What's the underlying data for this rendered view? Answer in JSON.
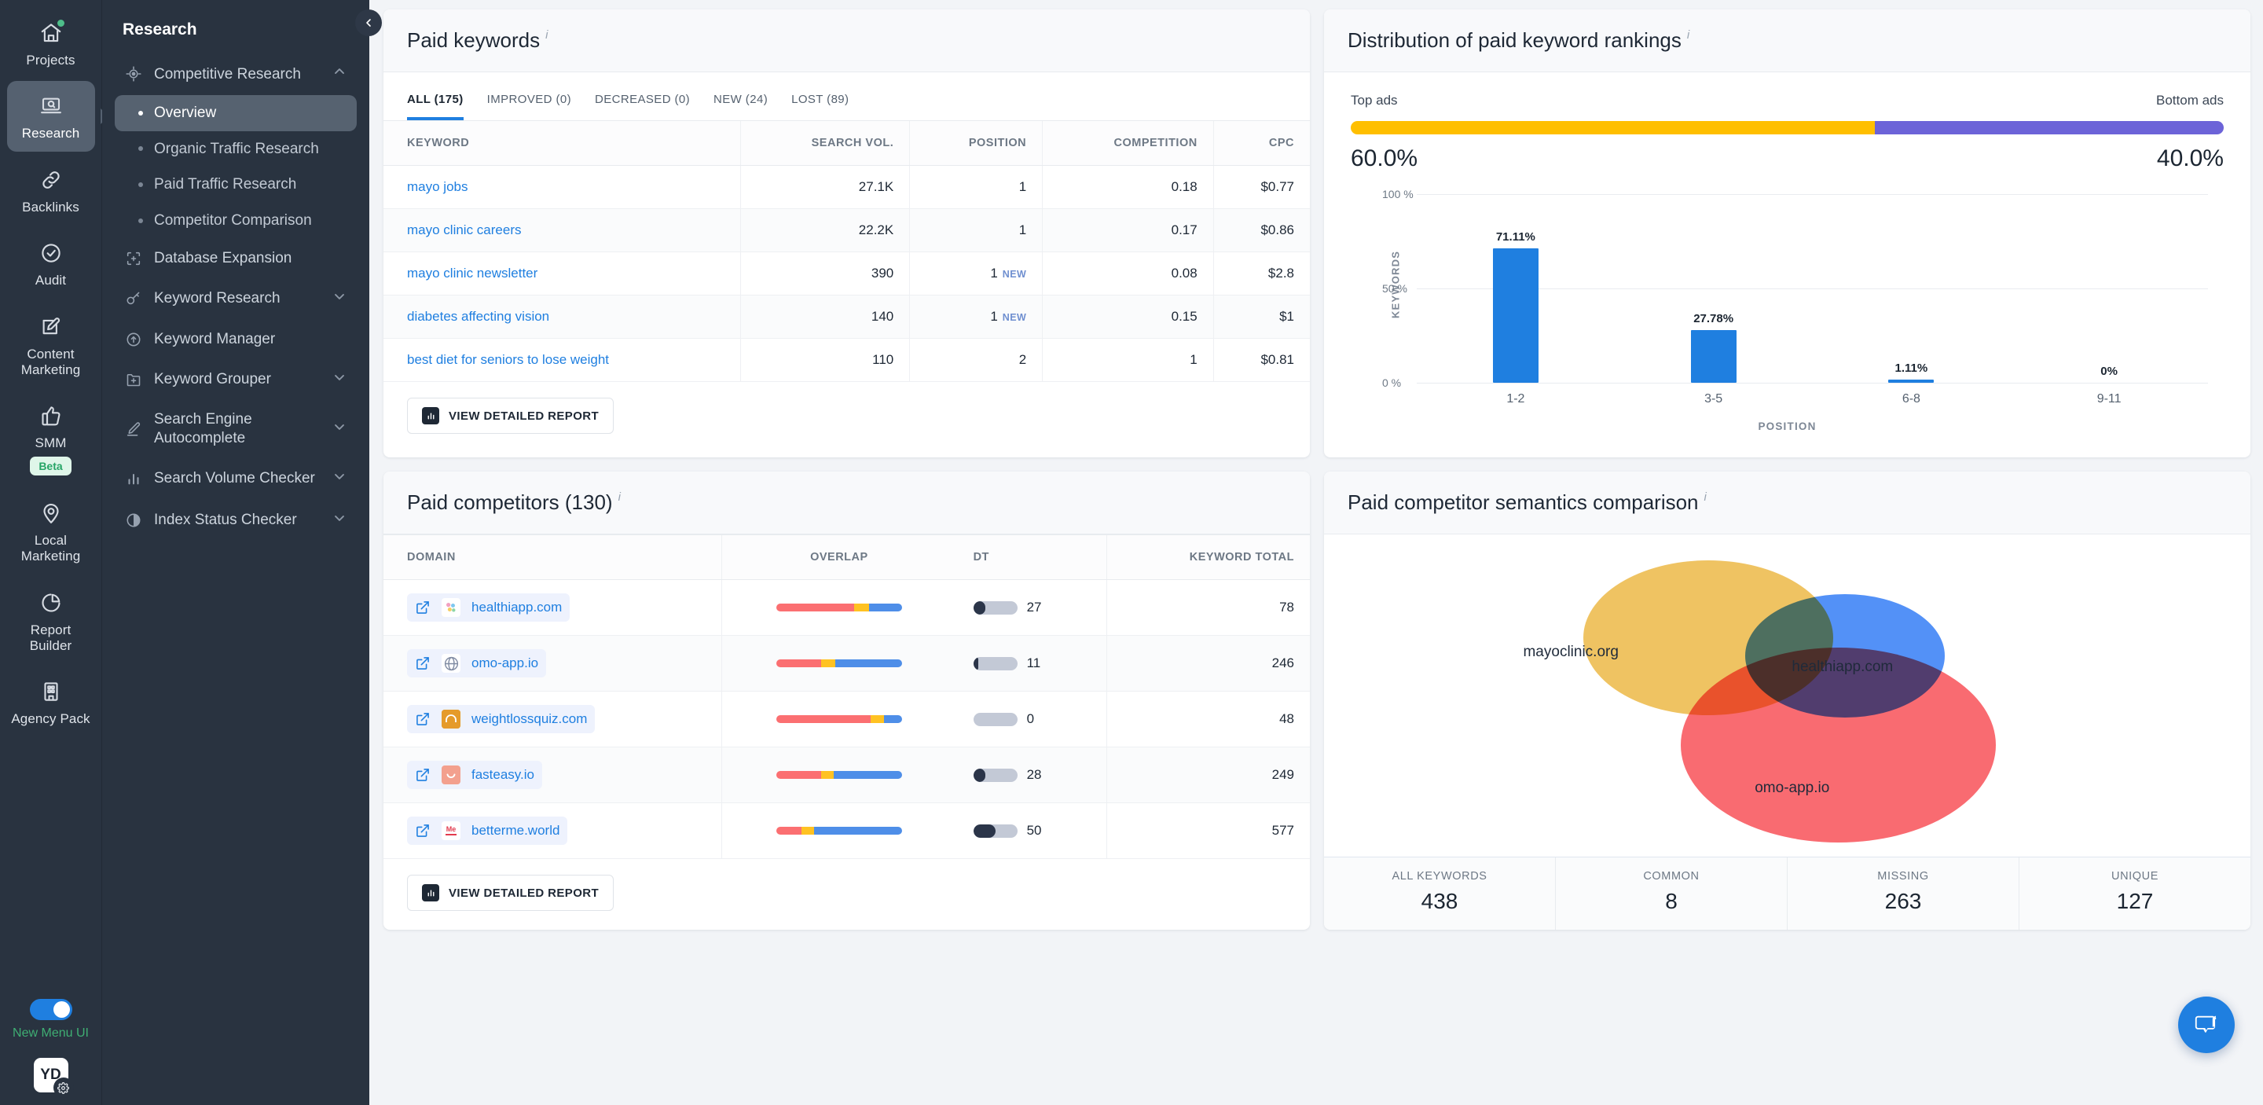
{
  "rail": {
    "items": [
      {
        "label": "Projects",
        "icon": "home-icon",
        "active": false,
        "badge_dot": true
      },
      {
        "label": "Research",
        "icon": "laptop-search-icon",
        "active": true,
        "badge_dot": false
      },
      {
        "label": "Backlinks",
        "icon": "link-icon",
        "active": false,
        "badge_dot": false
      },
      {
        "label": "Audit",
        "icon": "check-circle-icon",
        "active": false,
        "badge_dot": false
      },
      {
        "label": "Content Marketing",
        "icon": "edit-square-icon",
        "active": false,
        "badge_dot": false
      },
      {
        "label": "SMM",
        "icon": "thumbs-up-icon",
        "active": false,
        "badge_dot": false,
        "tag": "Beta"
      },
      {
        "label": "Local Marketing",
        "icon": "map-pin-icon",
        "active": false,
        "badge_dot": false
      },
      {
        "label": "Report Builder",
        "icon": "pie-chart-icon",
        "active": false,
        "badge_dot": false
      },
      {
        "label": "Agency Pack",
        "icon": "building-icon",
        "active": false,
        "badge_dot": false
      }
    ],
    "new_menu_label": "New Menu UI",
    "avatar_initials": "YD"
  },
  "nav": {
    "title": "Research",
    "groups": [
      {
        "label": "Competitive Research",
        "icon": "target-icon",
        "expanded": true,
        "chevron": "up",
        "children": [
          {
            "label": "Overview",
            "active": true
          },
          {
            "label": "Organic Traffic Research",
            "active": false
          },
          {
            "label": "Paid Traffic Research",
            "active": false
          },
          {
            "label": "Competitor Comparison",
            "active": false
          }
        ]
      },
      {
        "label": "Database Expansion",
        "icon": "expand-icon",
        "expanded": false,
        "chevron": "none",
        "children": []
      },
      {
        "label": "Keyword Research",
        "icon": "key-icon",
        "expanded": false,
        "chevron": "down",
        "children": []
      },
      {
        "label": "Keyword Manager",
        "icon": "arrow-up-circle-icon",
        "expanded": false,
        "chevron": "none",
        "children": []
      },
      {
        "label": "Keyword Grouper",
        "icon": "folder-plus-icon",
        "expanded": false,
        "chevron": "down",
        "children": []
      },
      {
        "label": "Search Engine Autocomplete",
        "icon": "pencil-icon",
        "expanded": false,
        "chevron": "down",
        "children": []
      },
      {
        "label": "Search Volume Checker",
        "icon": "bar-chart-icon",
        "expanded": false,
        "chevron": "down",
        "children": []
      },
      {
        "label": "Index Status Checker",
        "icon": "contrast-circle-icon",
        "expanded": false,
        "chevron": "down",
        "children": []
      }
    ]
  },
  "paid_keywords": {
    "title": "Paid keywords",
    "info_glyph": "i",
    "tabs": [
      {
        "label": "ALL (175)",
        "active": true
      },
      {
        "label": "IMPROVED (0)",
        "active": false
      },
      {
        "label": "DECREASED (0)",
        "active": false
      },
      {
        "label": "NEW (24)",
        "active": false
      },
      {
        "label": "LOST (89)",
        "active": false
      }
    ],
    "columns": [
      "KEYWORD",
      "SEARCH VOL.",
      "POSITION",
      "COMPETITION",
      "CPC"
    ],
    "rows": [
      {
        "keyword": "mayo jobs",
        "search_vol": "27.1K",
        "position": "1",
        "position_tag": "",
        "competition": "0.18",
        "cpc": "$0.77"
      },
      {
        "keyword": "mayo clinic careers",
        "search_vol": "22.2K",
        "position": "1",
        "position_tag": "",
        "competition": "0.17",
        "cpc": "$0.86"
      },
      {
        "keyword": "mayo clinic newsletter",
        "search_vol": "390",
        "position": "1",
        "position_tag": "NEW",
        "competition": "0.08",
        "cpc": "$2.8"
      },
      {
        "keyword": "diabetes affecting vision",
        "search_vol": "140",
        "position": "1",
        "position_tag": "NEW",
        "competition": "0.15",
        "cpc": "$1"
      },
      {
        "keyword": "best diet for seniors to lose weight",
        "search_vol": "110",
        "position": "2",
        "position_tag": "",
        "competition": "1",
        "cpc": "$0.81"
      }
    ],
    "report_button": "VIEW DETAILED REPORT"
  },
  "distribution": {
    "title": "Distribution of paid keyword rankings",
    "info_glyph": "i",
    "top_ads_label": "Top ads",
    "bottom_ads_label": "Bottom ads",
    "top_ads_pct": "60.0%",
    "bottom_ads_pct": "40.0%",
    "top_ads_color": "#FFBF00",
    "bottom_ads_color": "#6C63D8",
    "chart_data": {
      "type": "bar",
      "title": "Distribution of paid keyword rankings",
      "categories": [
        "1-2",
        "3-5",
        "6-8",
        "9-11"
      ],
      "values": [
        71.11,
        27.78,
        1.11,
        0
      ],
      "value_labels": [
        "71.11%",
        "27.78%",
        "1.11%",
        "0%"
      ],
      "xlabel": "POSITION",
      "ylabel": "KEYWORDS",
      "ylim": [
        0,
        100
      ],
      "ytick_labels": [
        "0 %",
        "50 %",
        "100 %"
      ],
      "ytick_values": [
        0,
        50,
        100
      ],
      "grid": true,
      "bar_color": "#1F7FE0",
      "legend": "none",
      "split": {
        "labels": [
          "Top ads",
          "Bottom ads"
        ],
        "values": [
          60.0,
          40.0
        ]
      }
    }
  },
  "paid_competitors": {
    "title": "Paid competitors (130)",
    "info_glyph": "i",
    "columns": [
      "DOMAIN",
      "OVERLAP",
      "DT",
      "KEYWORD TOTAL"
    ],
    "rows": [
      {
        "domain": "healthiapp.com",
        "overlap": [
          62,
          12,
          26
        ],
        "dt": 27,
        "dt_pct": 27,
        "keyword_total": "78",
        "favicon": "pinwheel-favicon",
        "favicon_bg": "#ffffff"
      },
      {
        "domain": "omo-app.io",
        "overlap": [
          36,
          11,
          53
        ],
        "dt": 11,
        "dt_pct": 11,
        "keyword_total": "246",
        "favicon": "globe-favicon",
        "favicon_bg": "#ffffff"
      },
      {
        "domain": "weightlossquiz.com",
        "overlap": [
          75,
          11,
          14
        ],
        "dt": 0,
        "dt_pct": 0,
        "keyword_total": "48",
        "favicon": "arch-favicon",
        "favicon_bg": "#E59B2A"
      },
      {
        "domain": "fasteasy.io",
        "overlap": [
          36,
          10,
          54
        ],
        "dt": 28,
        "dt_pct": 28,
        "keyword_total": "249",
        "favicon": "smile-favicon",
        "favicon_bg": "#F3A08E"
      },
      {
        "domain": "betterme.world",
        "overlap": [
          20,
          10,
          70
        ],
        "dt": 50,
        "dt_pct": 50,
        "keyword_total": "577",
        "favicon": "me-favicon",
        "favicon_bg": "#ffffff"
      }
    ],
    "overlap_colors": [
      "#FB6F71",
      "#FFC222",
      "#4E8EE8"
    ],
    "report_button": "VIEW DETAILED REPORT"
  },
  "semantics": {
    "title": "Paid competitor semantics comparison",
    "info_glyph": "i",
    "venn": [
      {
        "label": "mayoclinic.org",
        "color": "#EDBB4C"
      },
      {
        "label": "healthiapp.com",
        "color": "#3B82F6"
      },
      {
        "label": "omo-app.io",
        "color": "#F9565D"
      }
    ],
    "stats": [
      {
        "key": "ALL KEYWORDS",
        "value": "438"
      },
      {
        "key": "COMMON",
        "value": "8"
      },
      {
        "key": "MISSING",
        "value": "263"
      },
      {
        "key": "UNIQUE",
        "value": "127"
      }
    ]
  },
  "chat": {
    "icon": "chat-bubble-icon"
  }
}
